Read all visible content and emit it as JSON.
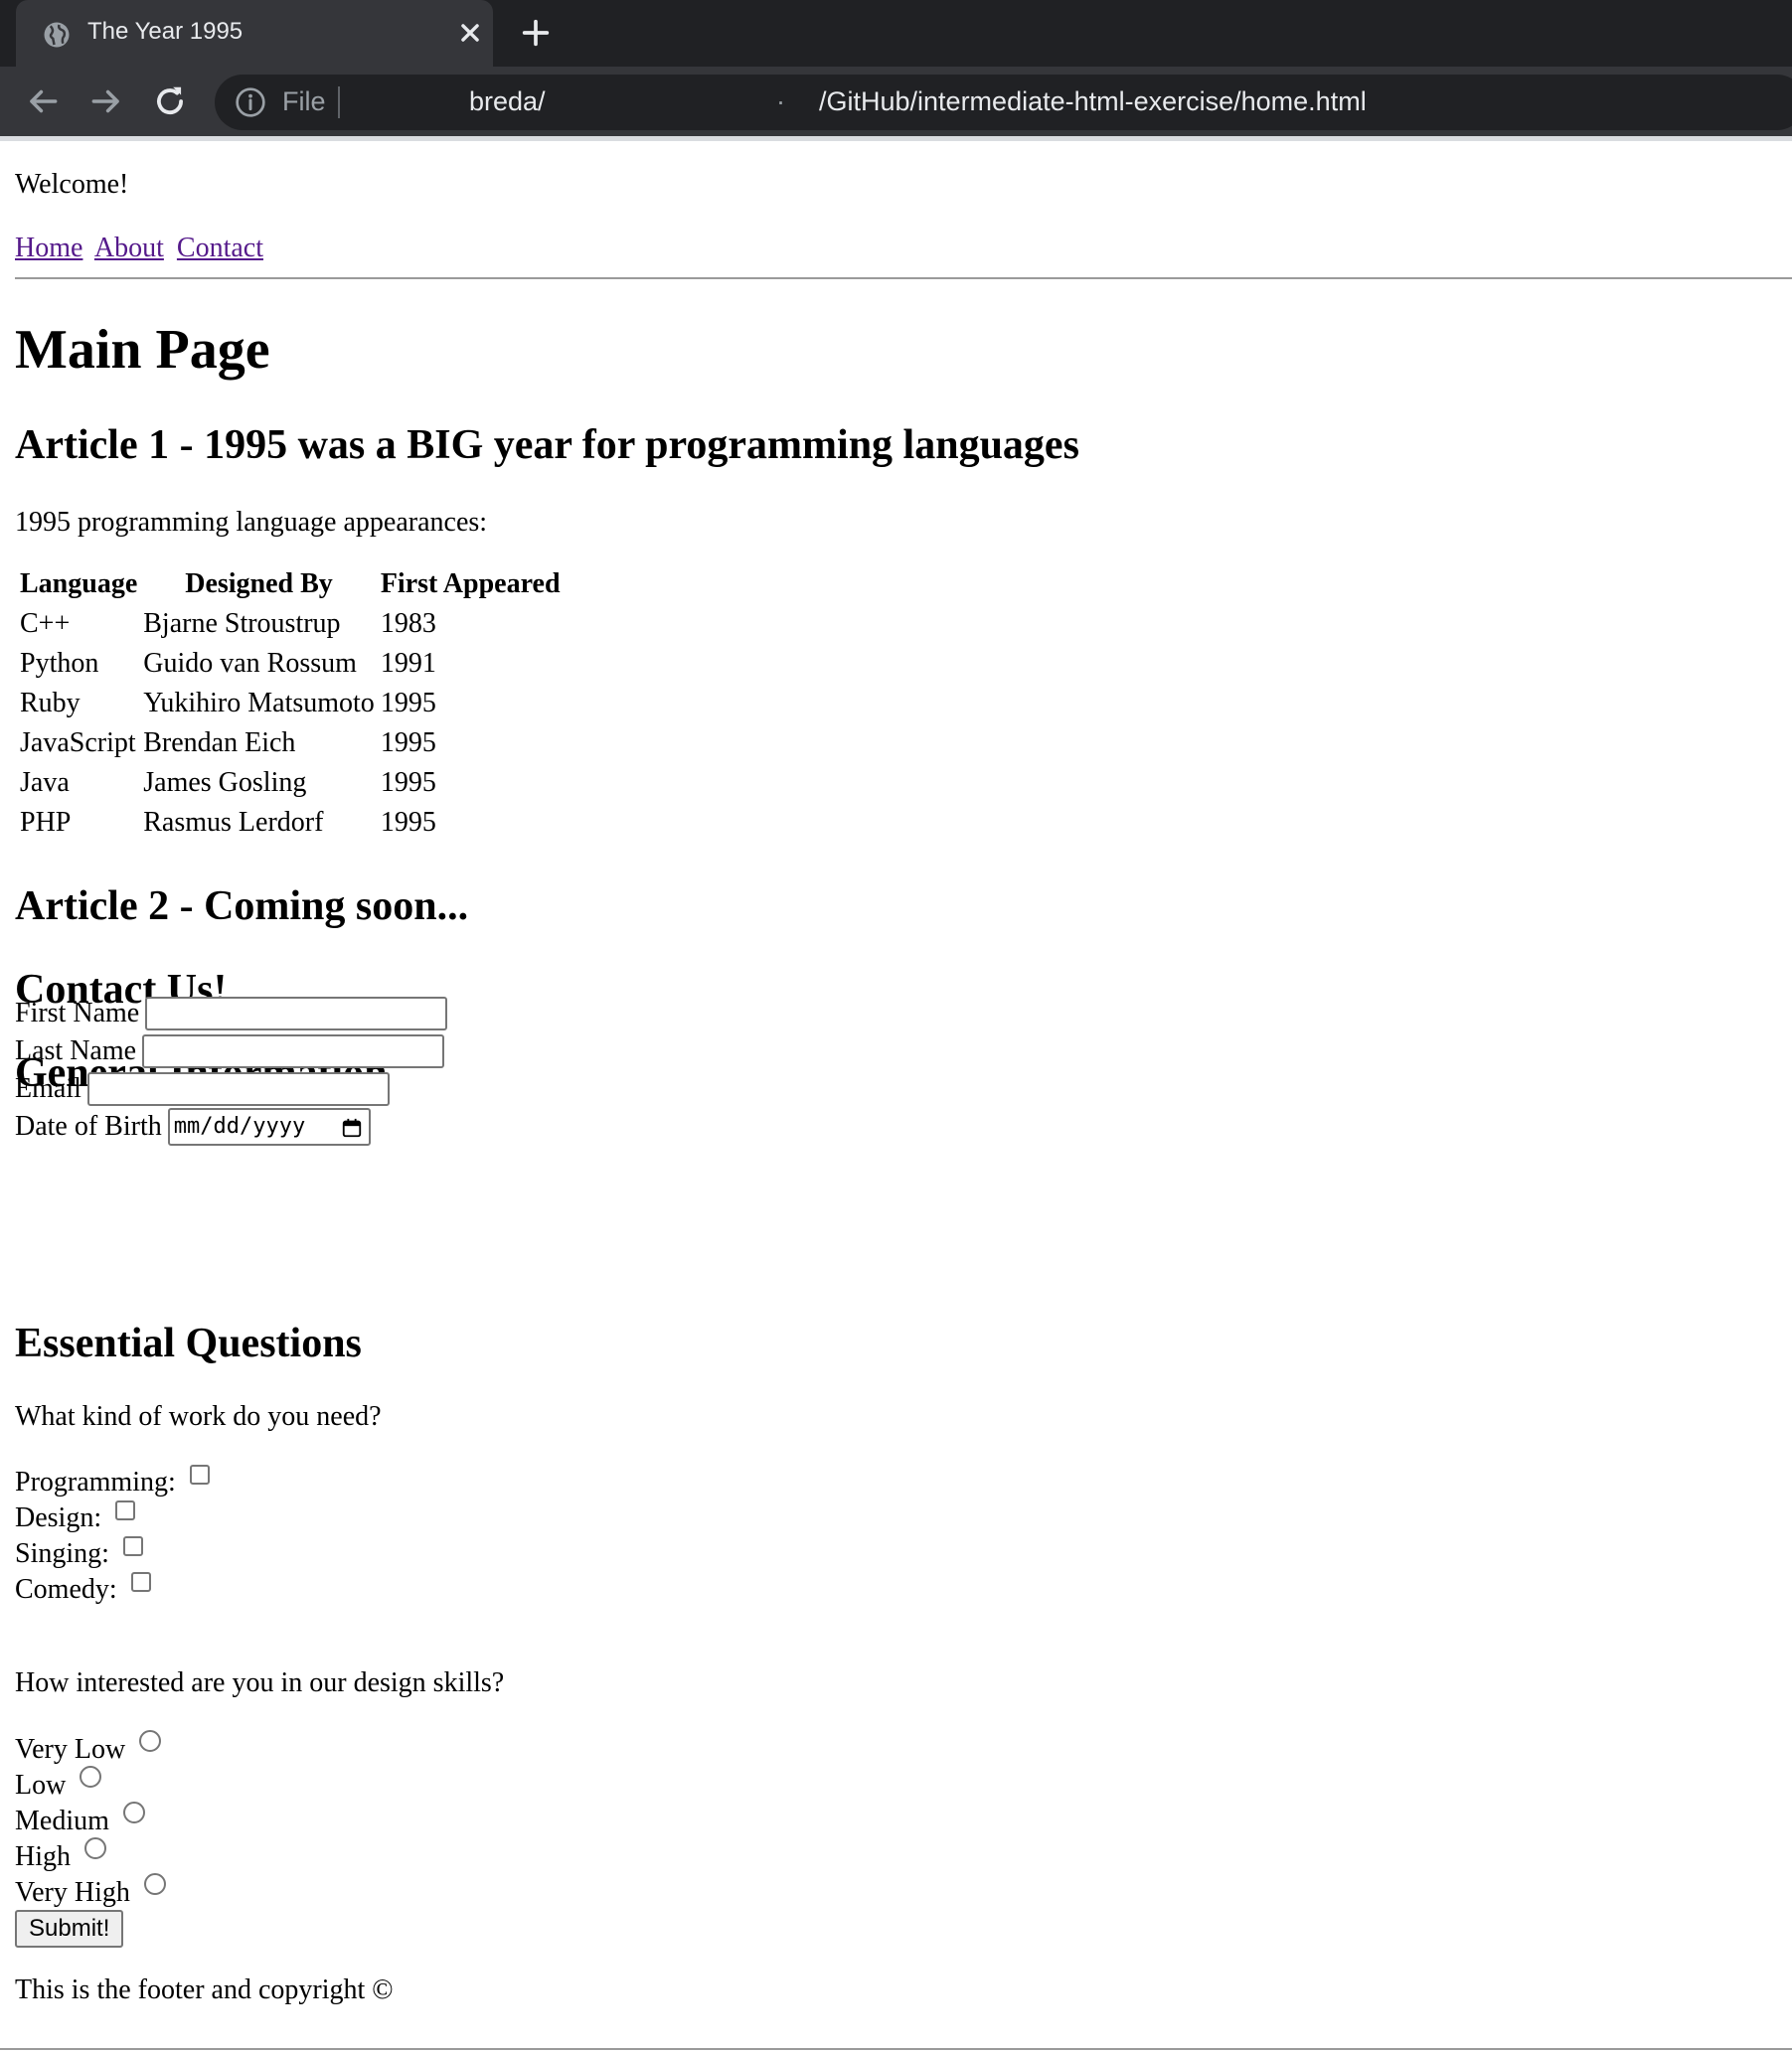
{
  "browser": {
    "tab_title": "The Year 1995",
    "url_scheme": "File",
    "url_part1": "breda/",
    "url_dot": "·",
    "url_part2": "/GitHub/intermediate-html-exercise/home.html"
  },
  "header": {
    "welcome": "Welcome!",
    "nav": [
      "Home",
      "About",
      "Contact"
    ]
  },
  "main": {
    "title": "Main Page",
    "article1_title": "Article 1 - 1995 was a BIG year for programming languages",
    "article1_intro": "1995 programming language appearances:",
    "table": {
      "headers": [
        "Language",
        "Designed By",
        "First Appeared"
      ],
      "rows": [
        [
          "C++",
          "Bjarne Stroustrup",
          "1983"
        ],
        [
          "Python",
          "Guido van Rossum",
          "1991"
        ],
        [
          "Ruby",
          "Yukihiro Matsumoto",
          "1995"
        ],
        [
          "JavaScript",
          "Brendan Eich",
          "1995"
        ],
        [
          "Java",
          "James Gosling",
          "1995"
        ],
        [
          "PHP",
          "Rasmus Lerdorf",
          "1995"
        ]
      ]
    },
    "article2_title": "Article 2 - Coming soon..."
  },
  "contact": {
    "title": "Contact Us!",
    "general_title": "General Information",
    "first_name_label": "First Name",
    "last_name_label": "Last Name",
    "email_label": "Email",
    "dob_label": "Date of Birth",
    "dob_placeholder": "mm/dd/yyyy",
    "essential_title": "Essential Questions",
    "q1": "What kind of work do you need?",
    "work_options": [
      "Programming:",
      "Design:",
      "Singing:",
      "Comedy:"
    ],
    "q2": "How interested are you in our design skills?",
    "interest_options": [
      "Very Low",
      "Low",
      "Medium",
      "High",
      "Very High"
    ],
    "submit_label": "Submit!"
  },
  "footer": {
    "text": "This is the footer and copyright ©"
  }
}
